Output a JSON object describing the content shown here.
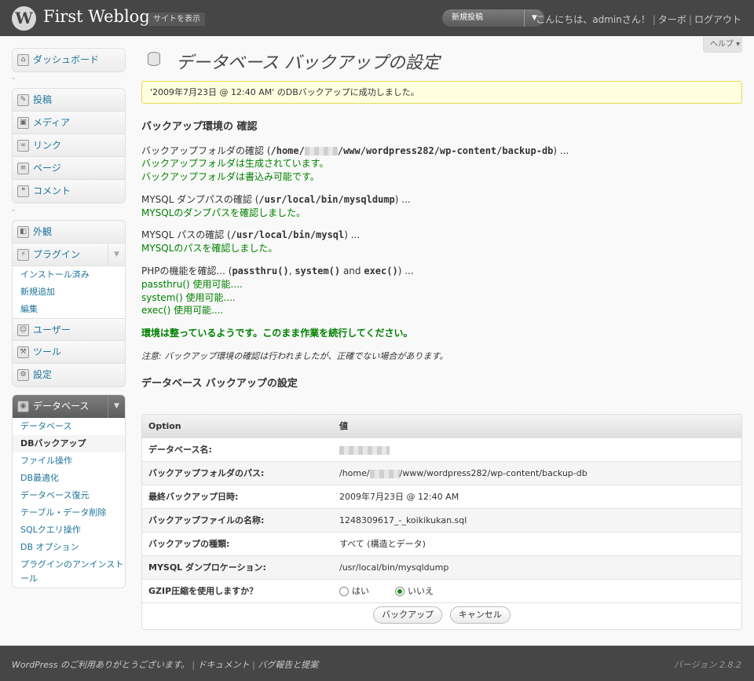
{
  "header": {
    "site_title": "First Weblog",
    "view_site": "サイトを表示",
    "new_post": "新規投稿",
    "greeting": "こんにちは、adminさん！",
    "turbo": "ターボ",
    "logout": "ログアウト"
  },
  "help": "ヘルプ",
  "sidebar": {
    "dashboard": "ダッシュボード",
    "posts": "投稿",
    "media": "メディア",
    "links": "リンク",
    "pages": "ページ",
    "comments": "コメント",
    "appearance": "外観",
    "plugins": "プラグイン",
    "plugins_sub": [
      "インストール済み",
      "新規追加",
      "編集"
    ],
    "users": "ユーザー",
    "tools": "ツール",
    "settings": "設定",
    "database": "データベース",
    "database_sub": [
      "データベース",
      "DBバックアップ",
      "ファイル操作",
      "DB最適化",
      "データベース復元",
      "テーブル・データ削除",
      "SQLクエリ操作",
      "DB オプション",
      "プラグインのアンインストール"
    ]
  },
  "page": {
    "title": "データベース バックアップの設定",
    "notice": "'2009年7月23日 @ 12:40 AM' のDBバックアップに成功しました。",
    "env_heading": "バックアップ環境の 確認",
    "folder_check_prefix": "バックアップフォルダの確認 (",
    "folder_path_a": "/home/",
    "folder_path_b": "/www/wordpress282/wp-content/backup-db",
    "folder_check_suffix": ") ...",
    "folder_created": "バックアップフォルダは生成されています。",
    "folder_writable": "バックアップフォルダは書込み可能です。",
    "dump_check_prefix": "MYSQL ダンプパスの確認 (",
    "dump_path": "/usr/local/bin/mysqldump",
    "dump_check_suffix": ") ...",
    "dump_ok": "MYSQLのダンプパスを確認しました。",
    "mysql_check_prefix": "MYSQL パスの確認 (",
    "mysql_path": "/usr/local/bin/mysql",
    "mysql_check_suffix": ") ...",
    "mysql_ok": "MYSQLのパスを確認しました。",
    "php_check_prefix": "PHPの機能を確認... (",
    "php_fn1": "passthru()",
    "php_sep1": ", ",
    "php_fn2": "system()",
    "php_sep2": " and ",
    "php_fn3": "exec()",
    "php_check_suffix": ") ...",
    "passthru_ok": "passthru() 使用可能....",
    "system_ok": "system() 使用可能....",
    "exec_ok": "exec() 使用可能....",
    "env_ok": "環境は整っているようです。このまま作業を続行してください。",
    "note": "注意: バックアップ環境の確認は行われましたが、正確でない場合があります。",
    "settings_heading": "データベース バックアップの設定"
  },
  "table": {
    "col_option": "Option",
    "col_value": "値",
    "rows": {
      "db_name": "データベース名:",
      "folder_path": "バックアップフォルダのパス:",
      "folder_path_a": "/home/",
      "folder_path_b": "/www/wordpress282/wp-content/backup-db",
      "last_backup": "最終バックアップ日時:",
      "last_backup_val": "2009年7月23日 @ 12:40 AM",
      "file_name": "バックアップファイルの名称:",
      "file_name_val": "1248309617_-_koikikukan.sql",
      "type": "バックアップの種類:",
      "type_val": "すべて (構造とデータ)",
      "dump_loc": "MYSQL ダンプロケーション:",
      "dump_loc_val": "/usr/local/bin/mysqldump",
      "gzip": "GZIP圧縮を使用しますか？",
      "gzip_yes": "はい",
      "gzip_no": "いいえ"
    },
    "backup_btn": "バックアップ",
    "cancel_btn": "キャンセル"
  },
  "footer": {
    "thanks": "WordPress のご利用ありがとうございます。",
    "docs": "ドキュメント",
    "bugs": "バグ報告と提案",
    "version": "バージョン 2.8.2"
  }
}
